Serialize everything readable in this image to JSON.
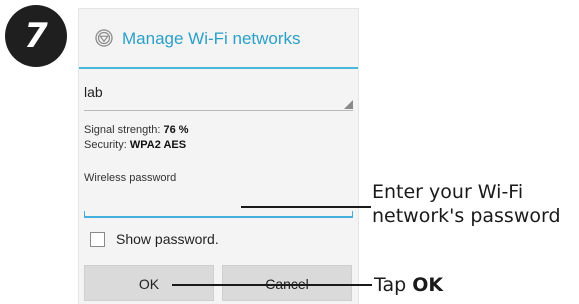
{
  "step": {
    "number": "7"
  },
  "dialog": {
    "title": "Manage Wi-Fi networks",
    "icon": "wifi-icon",
    "network_select": {
      "value": "lab"
    },
    "signal": {
      "label": "Signal strength:",
      "value": "76 %"
    },
    "security": {
      "label": "Security:",
      "value": "WPA2 AES"
    },
    "password": {
      "label": "Wireless password",
      "value": ""
    },
    "show_password": {
      "label": "Show password.",
      "checked": false
    },
    "buttons": {
      "ok": "OK",
      "cancel": "Cancel"
    },
    "colors": {
      "accent": "#2ba0c8",
      "rule": "#49b8dc"
    }
  },
  "callouts": {
    "password": {
      "line1": "Enter your Wi-Fi",
      "line2": "network's password"
    },
    "ok": {
      "prefix": "Tap",
      "bold": "OK"
    }
  }
}
